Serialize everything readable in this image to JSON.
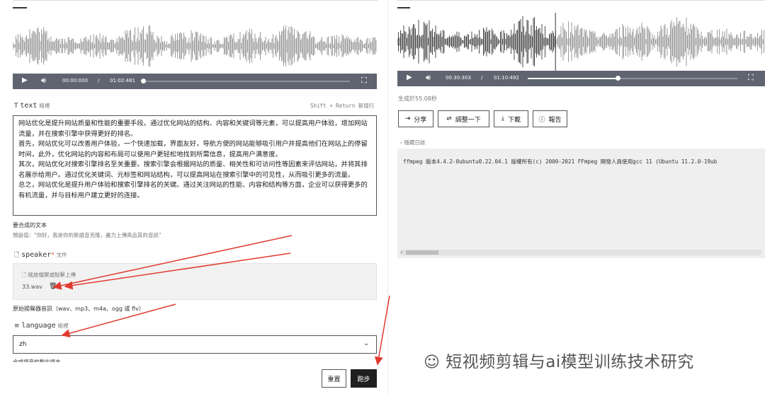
{
  "left": {
    "player": {
      "current_time": "00:00:000",
      "separator": "/",
      "duration": "01:02:481",
      "progress": 0.0
    },
    "text_field": {
      "icon": "text-icon",
      "label": "text",
      "sublabel": "組裡",
      "shortcut_hint": "Shift + Return 新增行",
      "paragraphs": [
        "网站优化是提升网站质量和性能的重要手段。通过优化网站的结构、内容和关键词等元素，可以提高用户体验，增加网站流量，并在搜索引擎中获得更好的排名。",
        "首先，网站优化可以改善用户体验，一个快速加载，界面友好，导航方便的网站能够吸引用户并提高他们在网站上的停留时间，此外，优化网站的内容和布局可以使用户更轻松地找到所需信息，提高用户满意度。",
        "其次，网站优化对搜索引擎排名至关重要。搜索引擎会根据网站的质量、相关性和可访问性等因素来评估网站，并将其排名展示给用户。通过优化关键词、元标签和网站结构，可以提高网站在搜索引擎中的可见性，从而吸引更多的流量。",
        "总之，网站优化是提升用户体验和搜索引擎排名的关键。通过关注网站的性能、内容和结构等方面，企业可以获得更多的有机流量，并与目标用户建立更好的连接。"
      ],
      "info": "要合成的文本",
      "default_hint": "預設值：\"你好，我是你的新語音克隆，盡力上傳高品質的音訊\""
    },
    "speaker_field": {
      "icon": "file-icon",
      "label": "speaker",
      "required_mark": "*",
      "sublabel": "文件",
      "upload_prompt": "拖放檔案或點擊上傳",
      "file_name": "33.wav",
      "info": "原始揚聲器音訊（wav、mp3、m4a、ogg 或 flv）"
    },
    "language_field": {
      "icon": "list-icon",
      "label": "language",
      "sublabel": "組裡",
      "value": "zh",
      "info": "合成語音的輸出語言"
    },
    "actions": {
      "reset": "重置",
      "run": "跑步"
    }
  },
  "right": {
    "player": {
      "current_time": "00:30:303",
      "separator": "/",
      "duration": "01:10:492",
      "progress": 0.43
    },
    "generated_time": "生成於55.08秒",
    "buttons": [
      {
        "label": "分享",
        "icon": "share-icon"
      },
      {
        "label": "調整一下",
        "icon": "sliders-icon"
      },
      {
        "label": "下載",
        "icon": "download-icon"
      },
      {
        "label": "報告",
        "icon": "info-icon"
      }
    ],
    "log_toggle": "隱藏日誌",
    "log_text": "ffmpeg 版本4.4.2-0ubuntu0.22.04.1 版權所有(c) 2000-2021 FFmpeg 開發人員使用gcc 11 (Ubuntu 11.2.0-19ub"
  },
  "watermark": "短视频剪辑与ai模型训练技术研究",
  "colors": {
    "player_bg": "#5f6470",
    "arrow": "#e03a2f",
    "waveform": "#9a9a9a",
    "waveform_played": "#4a4a4a"
  }
}
